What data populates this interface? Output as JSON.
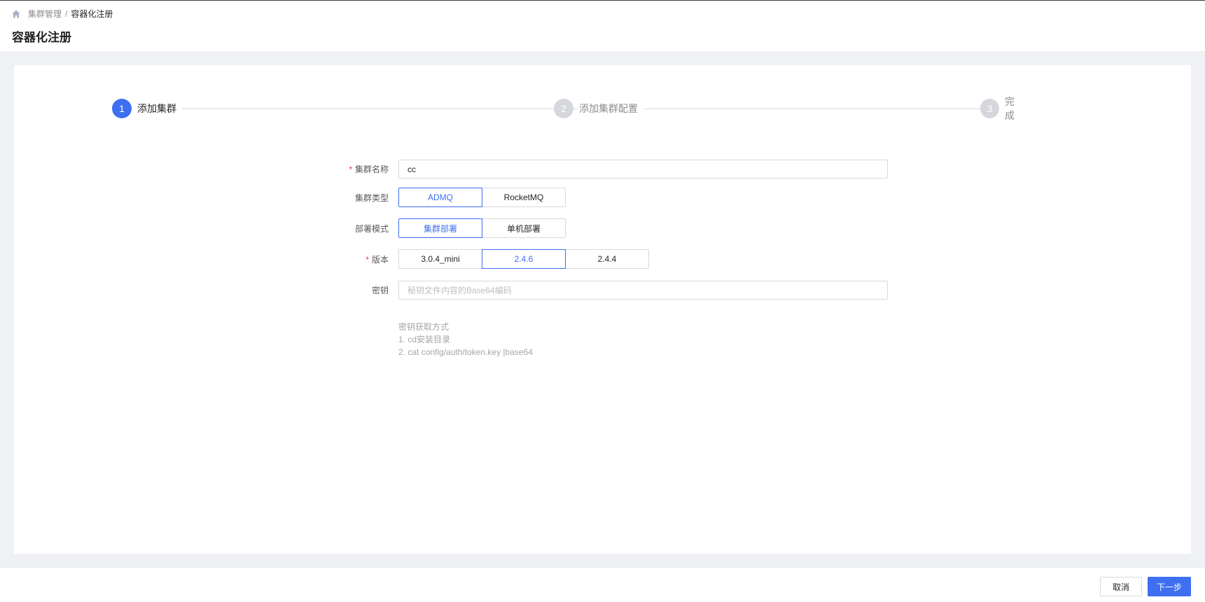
{
  "breadcrumb": {
    "home_icon": "home-icon",
    "parent": "集群管理",
    "separator": "/",
    "current": "容器化注册"
  },
  "page_title": "容器化注册",
  "steps": [
    {
      "number": "1",
      "label": "添加集群",
      "state": "active"
    },
    {
      "number": "2",
      "label": "添加集群配置",
      "state": "pending"
    },
    {
      "number": "3",
      "label": "完成",
      "state": "pending"
    }
  ],
  "form": {
    "cluster_name": {
      "label": "集群名称",
      "required": "*",
      "value": "cc"
    },
    "cluster_type": {
      "label": "集群类型",
      "options": [
        "ADMQ",
        "RocketMQ"
      ],
      "selected": "ADMQ"
    },
    "deploy_mode": {
      "label": "部署模式",
      "options": [
        "集群部署",
        "单机部署"
      ],
      "selected": "集群部署"
    },
    "version": {
      "label": "版本",
      "required": "*",
      "options": [
        "3.0.4_mini",
        "2.4.6",
        "2.4.4"
      ],
      "selected": "2.4.6"
    },
    "secret": {
      "label": "密钥",
      "value": "",
      "placeholder": "秘钥文件内容的Base64编码",
      "help": [
        "密钥获取方式",
        "1. cd安装目录",
        "2. cat config/auth/token.key |base64"
      ]
    }
  },
  "footer": {
    "cancel_label": "取消",
    "next_label": "下一步"
  },
  "colors": {
    "primary": "#3d6ff0",
    "required": "#e23c39",
    "step_pending": "#d5d7dc"
  }
}
